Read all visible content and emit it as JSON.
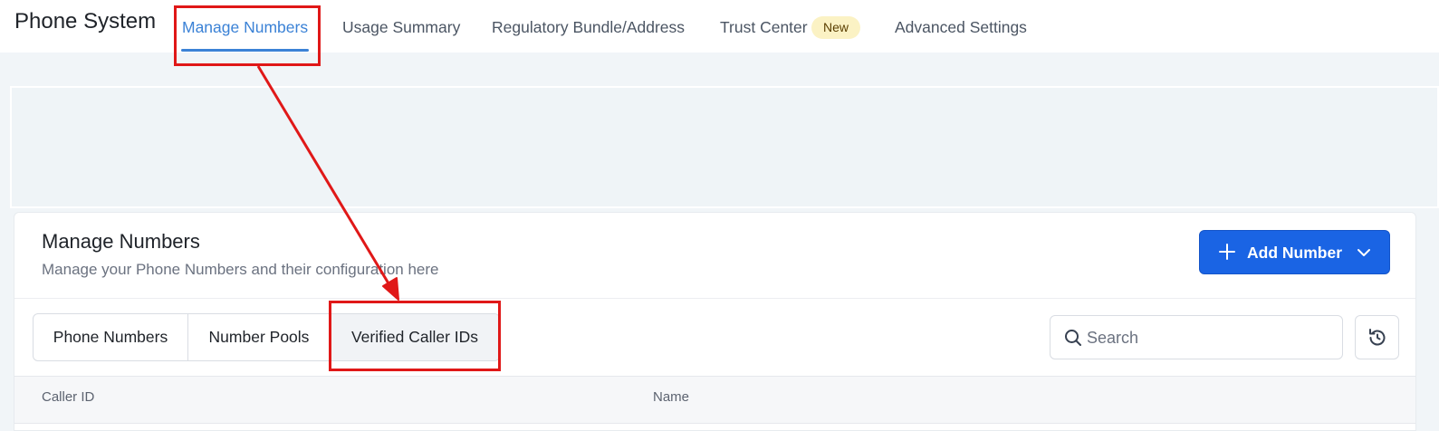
{
  "header": {
    "app_title": "Phone System",
    "tabs": [
      {
        "label": "Manage Numbers",
        "active": true
      },
      {
        "label": "Usage Summary",
        "active": false
      },
      {
        "label": "Regulatory Bundle/Address",
        "active": false
      },
      {
        "label": "Trust Center",
        "active": false,
        "badge": "New"
      },
      {
        "label": "Advanced Settings",
        "active": false
      }
    ]
  },
  "card": {
    "title": "Manage Numbers",
    "subtitle": "Manage your Phone Numbers and their configuration here",
    "add_button_label": "Add Number"
  },
  "subtabs": [
    {
      "label": "Phone Numbers",
      "active": false
    },
    {
      "label": "Number Pools",
      "active": false
    },
    {
      "label": "Verified Caller IDs",
      "active": true
    }
  ],
  "search": {
    "placeholder": "Search",
    "value": ""
  },
  "table": {
    "columns": [
      "Caller ID",
      "Name"
    ]
  },
  "colors": {
    "accent": "#1a64e4",
    "active_tab": "#3b82d6",
    "annotation": "#e01818",
    "badge_bg": "#fbf2c4"
  }
}
